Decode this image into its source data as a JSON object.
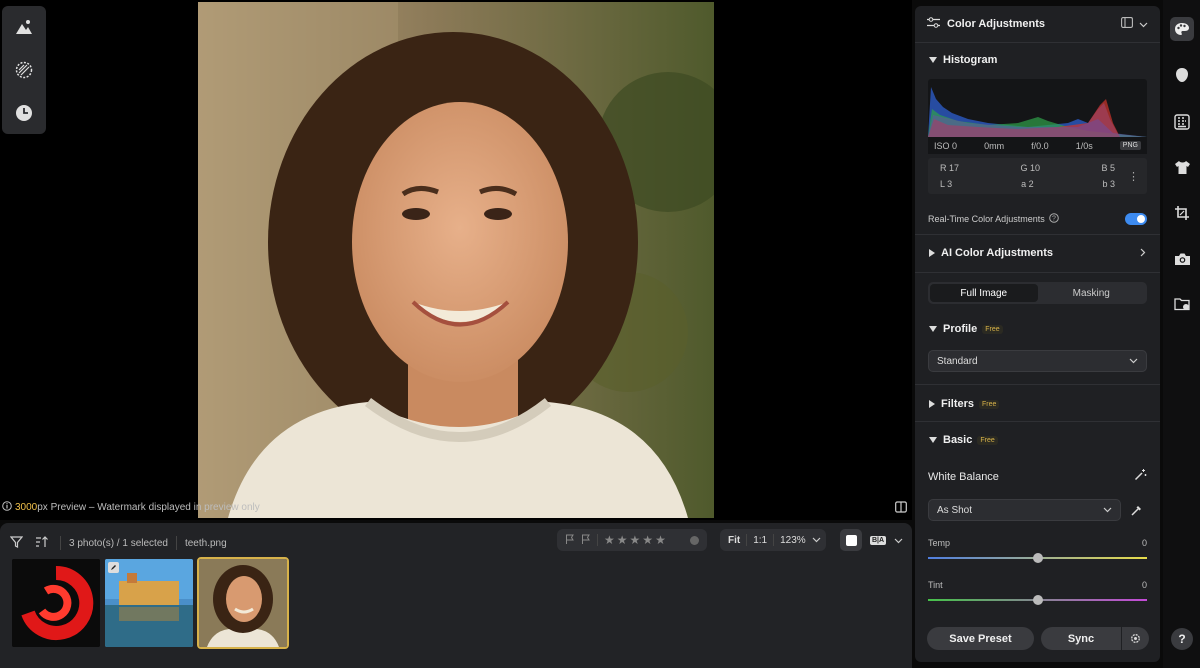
{
  "preview_note": {
    "px": "3000",
    "rest": "px Preview – Watermark displayed in preview only"
  },
  "filmstrip": {
    "count_text": "3 photo(s) / 1 selected",
    "filename": "teeth.png",
    "zoom": {
      "fit": "Fit",
      "one": "1:1",
      "level": "123%"
    },
    "view_mode": "B|A",
    "stars": 0
  },
  "panel": {
    "title": "Color Adjustments",
    "histogram": {
      "title": "Histogram",
      "exif": [
        "ISO 0",
        "0mm",
        "f/0.0",
        "1/0s"
      ],
      "format_badge": "PNG",
      "readout": [
        [
          "R 17",
          "G 10",
          "B 5"
        ],
        [
          "L 3",
          "a 2",
          "b 3"
        ]
      ]
    },
    "realtime": {
      "label": "Real-Time Color Adjustments",
      "on": true
    },
    "ai": {
      "title": "AI Color Adjustments"
    },
    "tabs": {
      "full": "Full Image",
      "masking": "Masking"
    },
    "profile": {
      "title": "Profile",
      "badge": "Free",
      "value": "Standard"
    },
    "filters": {
      "title": "Filters",
      "badge": "Free"
    },
    "basic": {
      "title": "Basic",
      "badge": "Free",
      "wb_label": "White Balance",
      "wb_value": "As Shot",
      "temp": {
        "label": "Temp",
        "value": "0",
        "pos": 0.5
      },
      "tint": {
        "label": "Tint",
        "value": "0",
        "pos": 0.5
      }
    },
    "buttons": {
      "save": "Save Preset",
      "sync": "Sync"
    }
  },
  "rail": {
    "help": "?"
  },
  "colors": {
    "accent": "#3d8bf0",
    "gold": "#d7b24a",
    "panel": "#1f2023"
  }
}
